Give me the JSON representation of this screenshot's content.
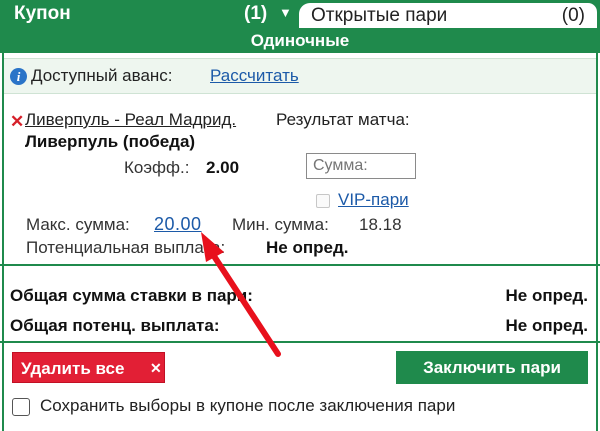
{
  "tabs": {
    "coupon_label": "Купон",
    "coupon_count": "(1)",
    "open_bets_label": "Открытые пари",
    "open_bets_count": "(0)"
  },
  "section_title": "Одиночные",
  "advance": {
    "label": "Доступный аванс:",
    "calculate_link": "Рассчитать"
  },
  "bet": {
    "match": "Ливерпуль - Реал Мадрид.",
    "market": "Результат матча:",
    "selection": "Ливерпуль (победа)",
    "coefficient_label": "Коэфф.:",
    "coefficient_value": "2.00",
    "amount_placeholder": "Сумма:",
    "vip_label": "VIP-пари",
    "max_label": "Макс. сумма:",
    "max_value": "20.00",
    "min_label": "Мин. сумма:",
    "min_value": "18.18",
    "potential_payout_label": "Потенциальная выплата:",
    "potential_payout_value": "Не опред."
  },
  "totals": {
    "total_stake_label": "Общая сумма ставки в пари:",
    "total_stake_value": "Не опред.",
    "total_payout_label": "Общая потенц. выплата:",
    "total_payout_value": "Не опред."
  },
  "actions": {
    "delete_all_label": "Удалить все",
    "place_bet_label": "Заключить пари",
    "save_selections_label": "Сохранить выборы в купоне после заключения пари"
  },
  "colors": {
    "brand_green": "#1f8a4c",
    "danger_red": "#e21f35",
    "link_blue": "#1c5aa8",
    "annotation_arrow": "#e8101c"
  }
}
